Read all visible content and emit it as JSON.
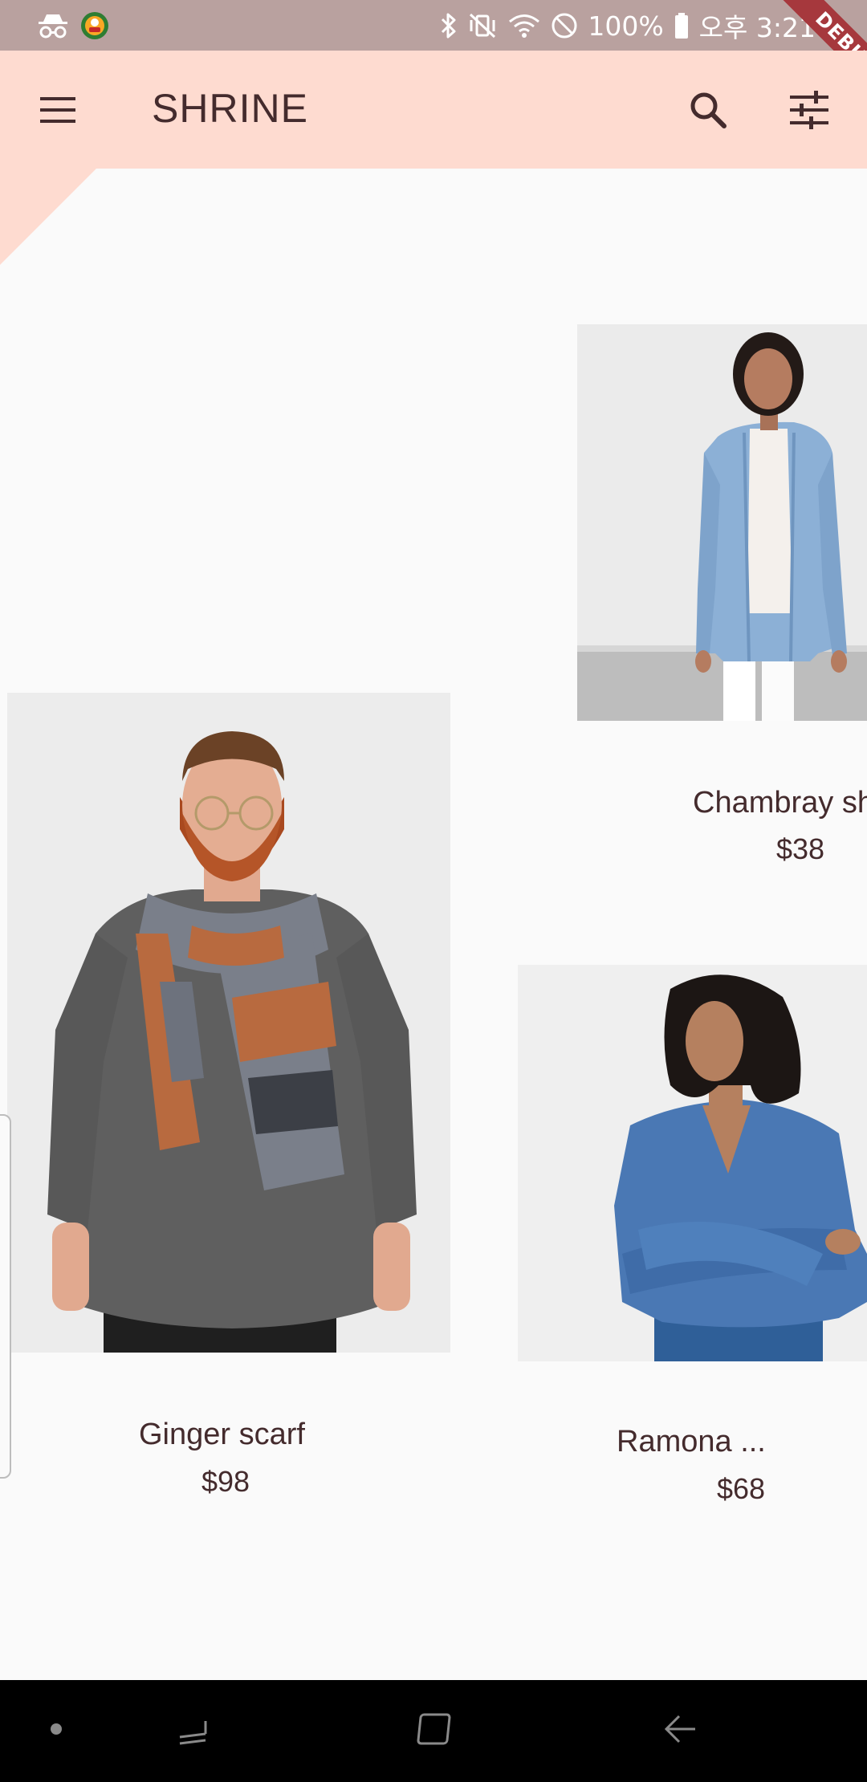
{
  "status_bar": {
    "left_icons": [
      "incognito-icon",
      "app-notification-icon"
    ],
    "right_icons": [
      "bluetooth-icon",
      "vibrate-mute-icon",
      "wifi-icon",
      "do-not-disturb-icon",
      "battery-icon"
    ],
    "battery": "100%",
    "time": "오후 3:21"
  },
  "debug_banner": {
    "label": "DEBUG"
  },
  "app_bar": {
    "title": "SHRINE",
    "menu_icon": "menu-icon",
    "search_icon": "search-icon",
    "filter_icon": "tune-icon",
    "background": "#fedbd0",
    "text_color": "#442b2d"
  },
  "products": [
    {
      "id": "chambray",
      "name": "Chambray sh",
      "price": "$38",
      "image": "woman-in-chambray-shirt"
    },
    {
      "id": "ginger-scarf",
      "name": "Ginger scarf",
      "price": "$98",
      "image": "man-in-plaid-scarf"
    },
    {
      "id": "ramona",
      "name": "Ramona ...",
      "price": "$68",
      "image": "woman-in-denim-wrap-top"
    }
  ],
  "nav_bar": {
    "buttons": [
      "dot-icon",
      "recents-icon",
      "home-icon",
      "back-icon"
    ]
  },
  "colors": {
    "status_bar": "#b9a19f",
    "accent_pink": "#fedbd0",
    "brown_text": "#442b2d",
    "page_bg": "#fafafa",
    "debug_ribbon": "#a6383d"
  }
}
